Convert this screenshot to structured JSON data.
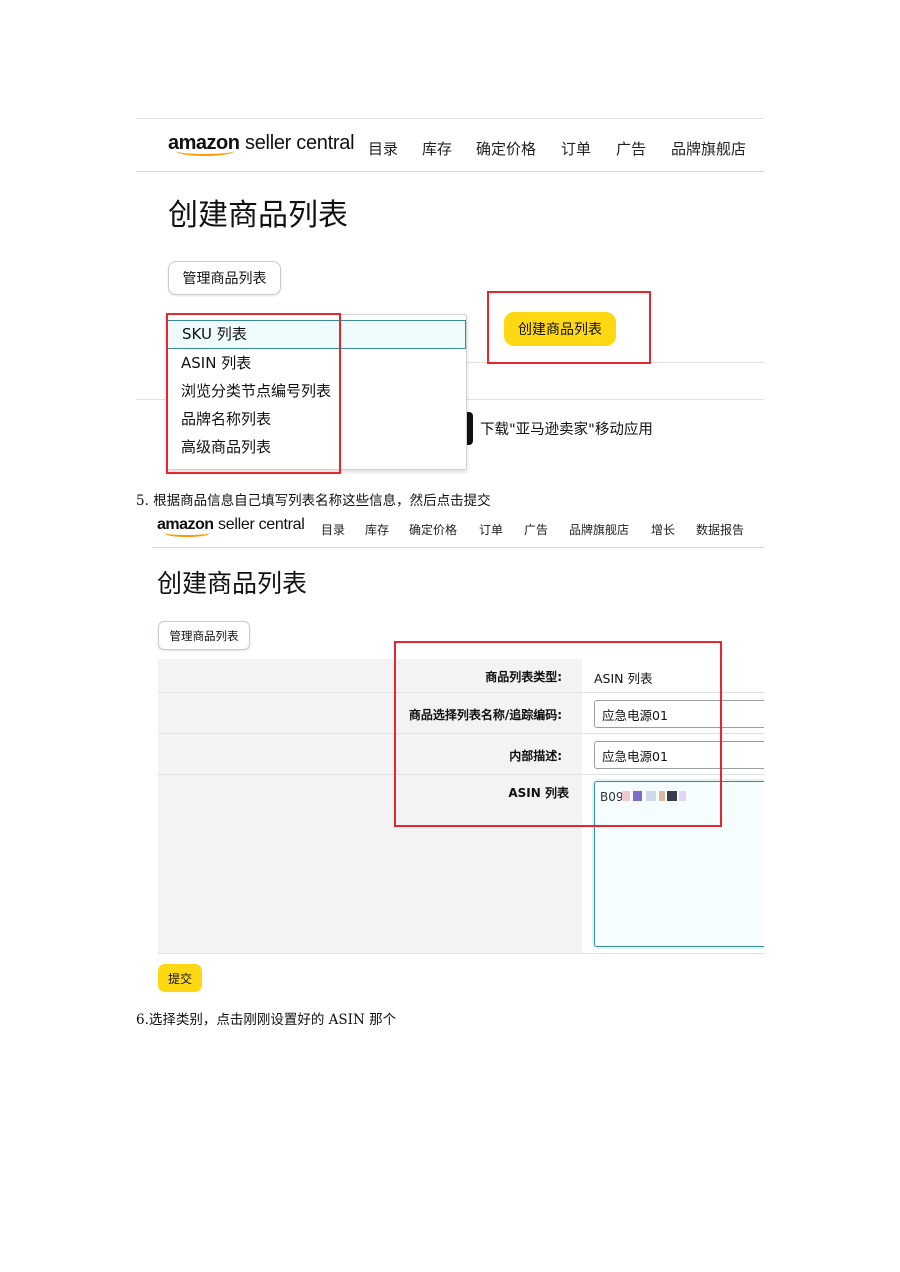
{
  "screenshot_1": {
    "logo": {
      "amazon": "amazon",
      "seller_central": "seller central"
    },
    "nav": [
      "目录",
      "库存",
      "确定价格",
      "订单",
      "广告",
      "品牌旗舰店"
    ],
    "page_title": "创建商品列表",
    "manage_button": "管理商品列表",
    "dropdown_options": [
      "SKU 列表",
      "ASIN 列表",
      "浏览分类节点编号列表",
      "品牌名称列表",
      "高级商品列表"
    ],
    "selected_option_index": 0,
    "create_button": "创建商品列表",
    "download_text": "下载\"亚马逊卖家\"移动应用"
  },
  "step5": "5.   根据商品信息自己填写列表名称这些信息，然后点击提交",
  "screenshot_2": {
    "logo": {
      "amazon": "amazon",
      "seller_central": "seller central"
    },
    "nav": [
      "目录",
      "库存",
      "确定价格",
      "订单",
      "广告",
      "品牌旗舰店",
      "增长",
      "数据报告"
    ],
    "page_title": "创建商品列表",
    "manage_button": "管理商品列表",
    "form": {
      "type_label": "商品列表类型:",
      "type_value": "ASIN 列表",
      "name_label": "商品选择列表名称/追踪编码:",
      "name_value": "应急电源01",
      "desc_label": "内部描述:",
      "desc_value": "应急电源01",
      "asin_label": "ASIN 列表",
      "asin_value": "B09"
    },
    "submit_button": "提交"
  },
  "step6": "6.选择类别，点击刚刚设置好的 ASIN 那个",
  "colors": {
    "highlight_red": "#e8262d",
    "amazon_yellow": "#ffd814",
    "amazon_orange": "#ff9900",
    "selected_teal": "#3a8c96"
  }
}
